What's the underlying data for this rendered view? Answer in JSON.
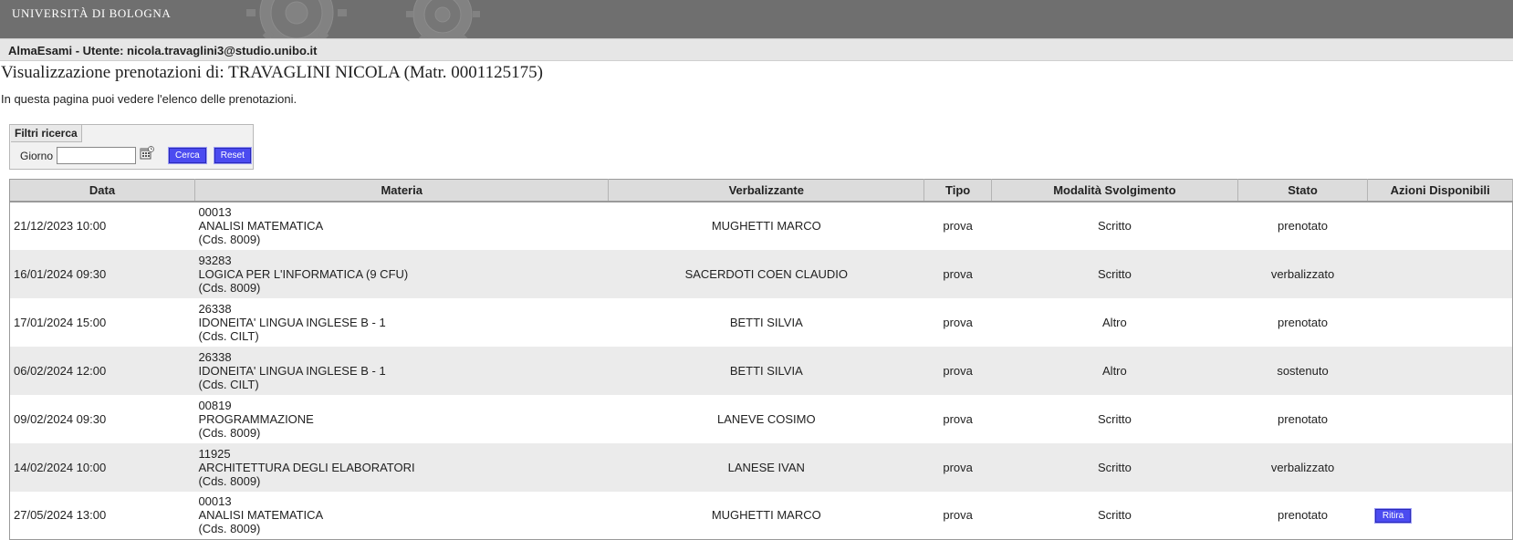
{
  "banner": {
    "university": "UNIVERSITÀ DI BOLOGNA"
  },
  "app_bar": {
    "text": "AlmaEsami - Utente: nicola.travaglini3@studio.unibo.it"
  },
  "page": {
    "title": "Visualizzazione prenotazioni di: TRAVAGLINI NICOLA (Matr. 0001125175)",
    "intro": "In questa pagina puoi vedere l'elenco delle prenotazioni."
  },
  "filters": {
    "legend": "Filtri ricerca",
    "giorno_label": "Giorno",
    "giorno_value": "",
    "calendar_icon": "calendar-icon",
    "search_label": "Cerca",
    "reset_label": "Reset"
  },
  "table": {
    "columns": [
      "Data",
      "Materia",
      "Verbalizzante",
      "Tipo",
      "Modalità Svolgimento",
      "Stato",
      "Azioni Disponibili"
    ],
    "rows": [
      {
        "data": "21/12/2023 10:00",
        "codice": "00013",
        "materia": "ANALISI MATEMATICA",
        "cds": "(Cds. 8009)",
        "verbalizzante": "MUGHETTI MARCO",
        "tipo": "prova",
        "modalita": "Scritto",
        "stato": "prenotato",
        "azione": ""
      },
      {
        "data": "16/01/2024 09:30",
        "codice": "93283",
        "materia": "LOGICA PER L'INFORMATICA (9 CFU)",
        "cds": "(Cds. 8009)",
        "verbalizzante": "SACERDOTI COEN CLAUDIO",
        "tipo": "prova",
        "modalita": "Scritto",
        "stato": "verbalizzato",
        "azione": ""
      },
      {
        "data": "17/01/2024 15:00",
        "codice": "26338",
        "materia": "IDONEITA' LINGUA INGLESE B - 1",
        "cds": "(Cds. CILT)",
        "verbalizzante": "BETTI SILVIA",
        "tipo": "prova",
        "modalita": "Altro",
        "stato": "prenotato",
        "azione": ""
      },
      {
        "data": "06/02/2024 12:00",
        "codice": "26338",
        "materia": "IDONEITA' LINGUA INGLESE B - 1",
        "cds": "(Cds. CILT)",
        "verbalizzante": "BETTI SILVIA",
        "tipo": "prova",
        "modalita": "Altro",
        "stato": "sostenuto",
        "azione": ""
      },
      {
        "data": "09/02/2024 09:30",
        "codice": "00819",
        "materia": "PROGRAMMAZIONE",
        "cds": "(Cds. 8009)",
        "verbalizzante": "LANEVE COSIMO",
        "tipo": "prova",
        "modalita": "Scritto",
        "stato": "prenotato",
        "azione": ""
      },
      {
        "data": "14/02/2024 10:00",
        "codice": "11925",
        "materia": "ARCHITETTURA DEGLI ELABORATORI",
        "cds": "(Cds. 8009)",
        "verbalizzante": "LANESE IVAN",
        "tipo": "prova",
        "modalita": "Scritto",
        "stato": "verbalizzato",
        "azione": ""
      },
      {
        "data": "27/05/2024 13:00",
        "codice": "00013",
        "materia": "ANALISI MATEMATICA",
        "cds": "(Cds. 8009)",
        "verbalizzante": "MUGHETTI MARCO",
        "tipo": "prova",
        "modalita": "Scritto",
        "stato": "prenotato",
        "azione": "Ritira"
      }
    ]
  },
  "colors": {
    "banner_bg": "#6f6f6f",
    "button_bg": "#4b4bf0",
    "header_bg": "#dcdcdc",
    "stripe_bg": "#ebebeb"
  }
}
